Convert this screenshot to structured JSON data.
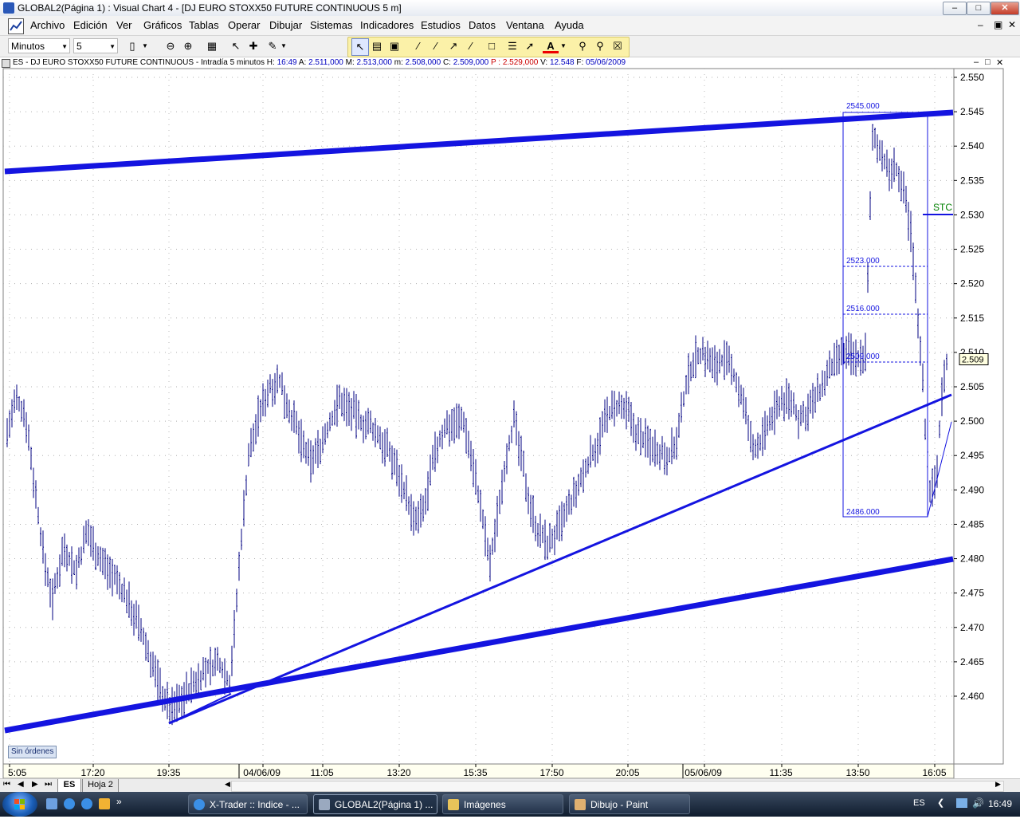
{
  "window": {
    "title": "GLOBAL2(Página 1) : Visual Chart 4 - [DJ EURO STOXX50 FUTURE CONTINUOUS 5 m]",
    "buttons": [
      "minimize",
      "restore",
      "close"
    ]
  },
  "menu": [
    "Archivo",
    "Edición",
    "Ver",
    "Gráficos",
    "Tablas",
    "Operar",
    "Dibujar",
    "Sistemas",
    "Indicadores",
    "Estudios",
    "Datos",
    "Ventana",
    "Ayuda"
  ],
  "toolbar": {
    "period_unit": "Minutos",
    "period_value": "5"
  },
  "chart_header": {
    "symbol": "ES",
    "description": "DJ EURO STOXX50 FUTURE CONTINUOUS - Intradía 5 minutos",
    "H_label": "H:",
    "H": "16:49",
    "A_label": "A:",
    "A": "2.511,000",
    "M_label": "M:",
    "M": "2.513,000",
    "m_label": "m:",
    "m": "2.508,000",
    "C_label": "C:",
    "C": "2.509,000",
    "P_label": "P :",
    "P": "2.529,000",
    "V_label": "V:",
    "V": "12.548",
    "F_label": "F:",
    "F": "05/06/2009"
  },
  "colors": {
    "trendline": "#1414e0",
    "price": "#000080",
    "header_value": "#0000c0",
    "stop_label": "#008000",
    "P_value": "#cc0000"
  },
  "chart_data": {
    "type": "bar",
    "ylim": [
      2.455,
      2.552
    ],
    "y_ticks": [
      "2.550",
      "2.545",
      "2.540",
      "2.535",
      "2.530",
      "2.525",
      "2.520",
      "2.515",
      "2.510",
      "2.505",
      "2.500",
      "2.495",
      "2.490",
      "2.485",
      "2.480",
      "2.475",
      "2.470",
      "2.465",
      "2.460"
    ],
    "x_ticks": [
      "5:05",
      "17:20",
      "19:35",
      "04/06/09",
      "11:05",
      "13:20",
      "15:35",
      "17:50",
      "20:05",
      "05/06/09",
      "11:35",
      "13:50",
      "16:05"
    ],
    "last_price_label": "2.509",
    "annotations": {
      "box_high": "2545.000",
      "box_low": "2486.000",
      "level_1": "2523.000",
      "level_2": "2516.000",
      "level_3": "2509.000",
      "stop_label": "STC"
    },
    "orders_label": "Sin órdenes"
  },
  "sheets": [
    "ES",
    "Hoja 2"
  ],
  "taskbar": {
    "buttons": [
      "X-Trader :: Indice - ...",
      "GLOBAL2(Página 1) ...",
      "Imágenes",
      "Dibujo - Paint"
    ],
    "lang": "ES",
    "clock": "16:49"
  }
}
